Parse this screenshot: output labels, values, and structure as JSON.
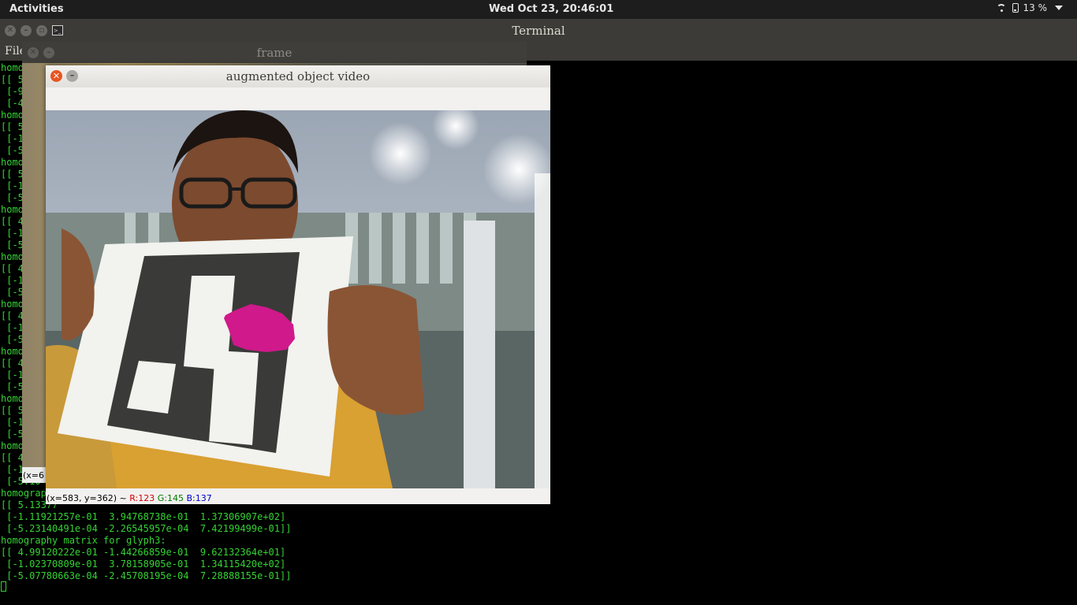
{
  "topbar": {
    "activities": "Activities",
    "clock": "Wed Oct 23, 20:46:01",
    "battery": "13 %",
    "icons": [
      "wifi-icon",
      "battery-icon",
      "system-menu-caret-icon"
    ]
  },
  "terminal": {
    "title": "Terminal",
    "menu_file": "File",
    "text_color": "#34d334",
    "lines": [
      "homo",
      "[[ 5",
      " [-9",
      " [-4",
      "homo",
      "[[ 5",
      " [-1",
      " [-5",
      "homo",
      "[[ 5",
      " [-1",
      " [-5",
      "homo",
      "[[ 4",
      " [-1",
      " [-5",
      "homo",
      "[[ 4",
      " [-1",
      " [-5",
      "homo",
      "[[ 4",
      " [-1",
      " [-5",
      "homo",
      "[[ 4",
      " [-1",
      " [-5",
      "homo",
      "[[ 5",
      " [-1",
      " [-5",
      "homo",
      "[[ 4",
      " [-1",
      " [-5.10",
      "homography matrix for glyph3:",
      "[[ 5.13377",
      " [-1.11921257e-01  3.94768738e-01  1.37306907e+02]",
      " [-5.23140491e-04 -2.26545957e-04  7.42199499e-01]]",
      "homography matrix for glyph3:",
      "[[ 4.99120222e-01 -1.44266859e-01  9.62132364e+01]",
      " [-1.02370809e-01  3.78158905e-01  1.34115420e+02]",
      " [-5.07780663e-04 -2.45708195e-04  7.28888155e-01]]"
    ]
  },
  "frame_window": {
    "title": "frame",
    "status": "(x=6"
  },
  "aug_window": {
    "title": "augmented object video",
    "status_coord": "(x=583, y=362) ~",
    "status_r": "R:123",
    "status_g": "G:145",
    "status_b": "B:137",
    "overlay_color": "#d0198b"
  }
}
